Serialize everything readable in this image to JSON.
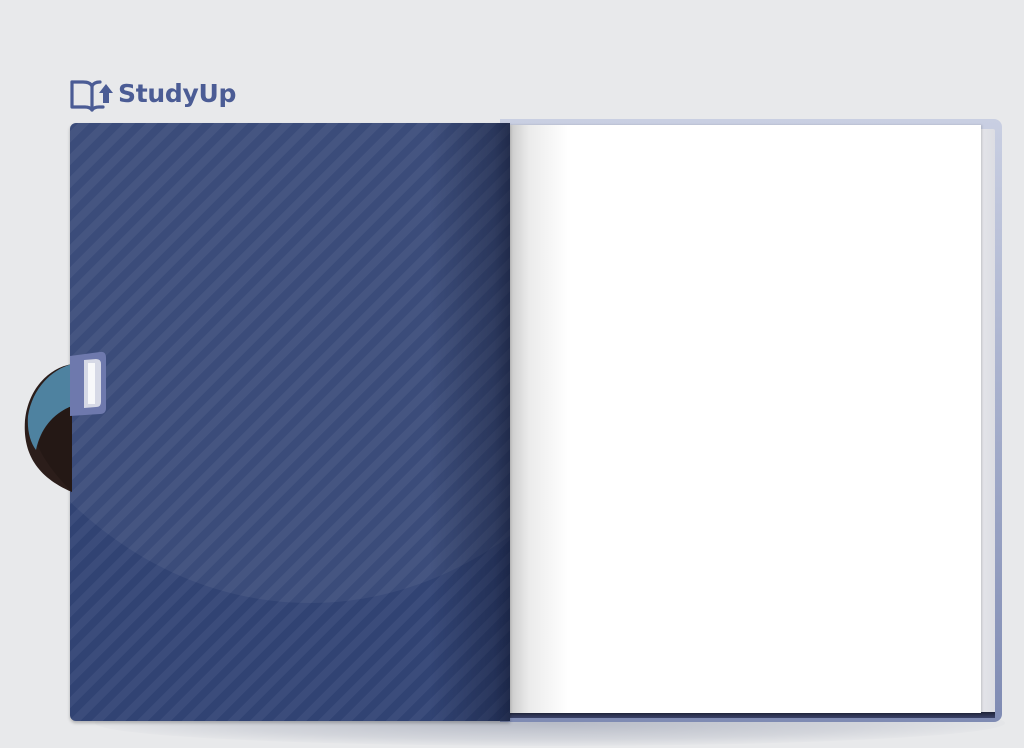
{
  "brand": {
    "name": "StudyUp",
    "color": "#4b5c95"
  },
  "book": {
    "cover_color": "#324475",
    "page_color": "#ffffff",
    "bookmark_color": "#5f7fae"
  },
  "icons": {
    "logo": "open-book-up-arrow-icon",
    "bookmark": "ribbon-bookmark-icon"
  }
}
